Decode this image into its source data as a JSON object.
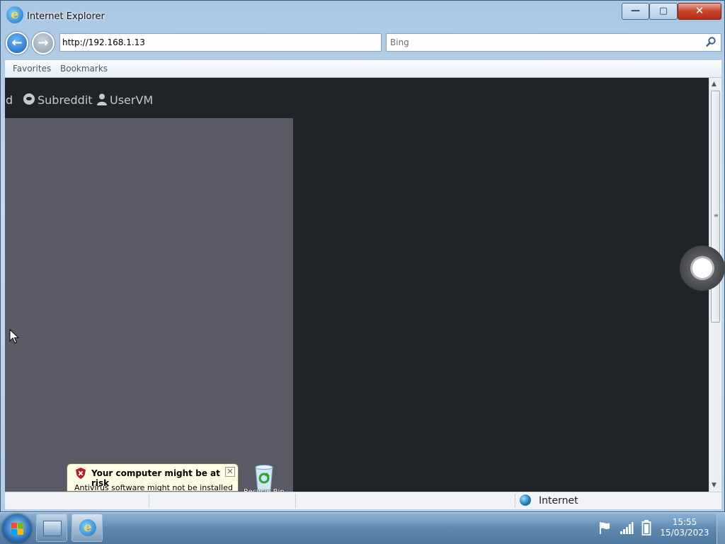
{
  "window": {
    "title": "Internet Explorer",
    "minimize_glyph": "—",
    "maximize_glyph": "▢",
    "close_glyph": "✕"
  },
  "nav": {
    "address": "http://192.168.1.13",
    "search_placeholder": "Bing",
    "back_glyph": "←",
    "forward_glyph": "→"
  },
  "favorites": {
    "items": [
      {
        "label": "Favorites"
      },
      {
        "label": "Bookmarks"
      }
    ]
  },
  "page": {
    "nav_partial": "d",
    "subreddit_label": "Subreddit",
    "user_label": "UserVM",
    "colors": {
      "background": "#202327",
      "panel": "#5a5a66",
      "nav_text": "#c5c8cc"
    }
  },
  "notification": {
    "title": "Your computer might be at risk",
    "body": "Antivirus software might not be installed",
    "close_glyph": "✕"
  },
  "desktop": {
    "recycle_bin_label": "Recycle Bin"
  },
  "status_bar": {
    "zone": "Internet"
  },
  "taskbar": {
    "time": "15:55",
    "date": "15/03/2023"
  },
  "icons": {
    "ie": "ie-logo-icon",
    "search": "search-icon",
    "subreddit": "subreddit-icon",
    "user": "user-icon",
    "shield": "shield-icon",
    "recycle_bin": "recycle-bin-icon",
    "globe": "globe-icon",
    "flag": "flag-icon",
    "network": "network-icon",
    "power": "power-icon"
  }
}
